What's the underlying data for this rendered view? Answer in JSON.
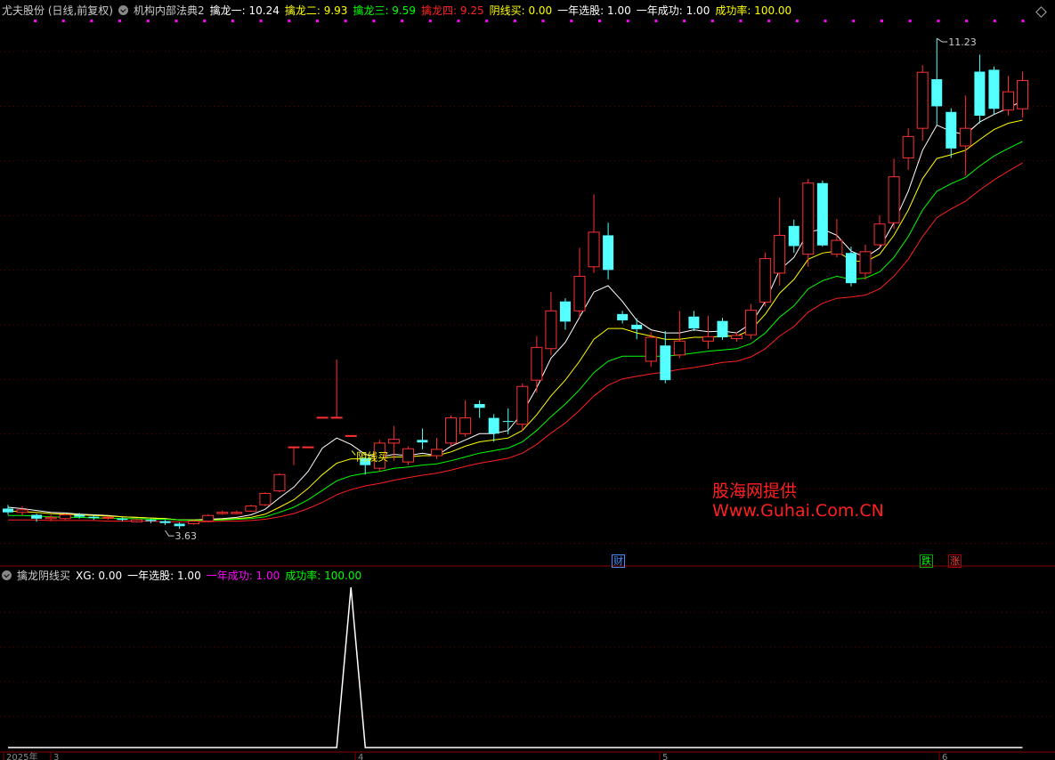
{
  "header": {
    "stock": "尤夫股份 (日线,前复权)",
    "indicator": "机构内部法典2",
    "items": [
      {
        "label": "擒龙一: 10.24",
        "color": "#ffffff"
      },
      {
        "label": "擒龙二: 9.93",
        "color": "#ffff00"
      },
      {
        "label": "擒龙三: 9.59",
        "color": "#00ff00"
      },
      {
        "label": "擒龙四: 9.25",
        "color": "#ff2020"
      },
      {
        "label": "阴线买: 0.00",
        "color": "#ffff00"
      },
      {
        "label": "一年选股: 1.00",
        "color": "#ffffff"
      },
      {
        "label": "一年成功: 1.00",
        "color": "#ffffff"
      },
      {
        "label": "成功率: 100.00",
        "color": "#ffff00"
      }
    ]
  },
  "sub_header": {
    "title": "擒龙阴线买",
    "items": [
      {
        "label": "XG: 0.00",
        "color": "#ffffff"
      },
      {
        "label": "一年选股: 1.00",
        "color": "#ffffff"
      },
      {
        "label": "一年成功: 1.00",
        "color": "#ff00ff"
      },
      {
        "label": "成功率: 100.00",
        "color": "#00ff00"
      }
    ]
  },
  "watermark": {
    "line1": "股海网提供",
    "line2": "Www.Guhai.Com.CN",
    "color": "#ff2020"
  },
  "annotations": {
    "high": "11.23",
    "low": "3.63",
    "signal": "阴线买"
  },
  "flags": [
    {
      "text": "财",
      "color": "#4a8cff"
    },
    {
      "text": "跌",
      "color": "#00ff00"
    },
    {
      "text": "涨",
      "color": "#ff2020"
    }
  ],
  "time_axis": [
    "2025年",
    "3",
    "4",
    "5",
    "6"
  ],
  "colors": {
    "up": "#ff3030",
    "down": "#54ffff",
    "bg": "#000000",
    "grid": "#7a0000"
  },
  "chart_data": {
    "type": "candlestick",
    "ylim": [
      3.3,
      11.4
    ],
    "candles": [
      [
        3.76,
        3.7,
        3.82,
        3.66
      ],
      [
        3.7,
        3.74,
        3.8,
        3.65
      ],
      [
        3.66,
        3.6,
        3.68,
        3.55
      ],
      [
        3.6,
        3.62,
        3.66,
        3.56
      ],
      [
        3.6,
        3.66,
        3.68,
        3.58
      ],
      [
        3.66,
        3.63,
        3.69,
        3.6
      ],
      [
        3.63,
        3.61,
        3.66,
        3.58
      ],
      [
        3.61,
        3.62,
        3.64,
        3.58
      ],
      [
        3.6,
        3.58,
        3.62,
        3.56
      ],
      [
        3.55,
        3.58,
        3.6,
        3.54
      ],
      [
        3.58,
        3.56,
        3.6,
        3.53
      ],
      [
        3.56,
        3.53,
        3.58,
        3.5
      ],
      [
        3.52,
        3.48,
        3.54,
        3.44
      ],
      [
        3.52,
        3.56,
        3.58,
        3.5
      ],
      [
        3.56,
        3.65,
        3.67,
        3.55
      ],
      [
        3.68,
        3.7,
        3.73,
        3.66
      ],
      [
        3.68,
        3.7,
        3.73,
        3.67
      ],
      [
        3.72,
        3.8,
        3.82,
        3.71
      ],
      [
        3.82,
        4.0,
        4.02,
        3.8
      ],
      [
        4.04,
        4.3,
        4.32,
        4.02
      ],
      [
        4.74,
        4.74,
        4.74,
        4.45
      ],
      [
        4.74,
        4.74,
        4.74,
        4.74
      ],
      [
        5.21,
        5.21,
        5.21,
        5.21
      ],
      [
        5.21,
        5.21,
        6.13,
        5.21
      ],
      [
        4.92,
        4.92,
        4.92,
        4.92
      ],
      [
        4.56,
        4.45,
        4.56,
        4.3
      ],
      [
        4.4,
        4.8,
        4.85,
        4.35
      ],
      [
        4.8,
        4.86,
        5.07,
        4.52
      ],
      [
        4.5,
        4.71,
        4.75,
        4.45
      ],
      [
        4.85,
        4.81,
        5.03,
        4.7
      ],
      [
        4.6,
        4.7,
        4.88,
        4.55
      ],
      [
        4.8,
        5.2,
        5.24,
        4.75
      ],
      [
        4.95,
        5.2,
        5.48,
        4.9
      ],
      [
        5.42,
        5.36,
        5.48,
        5.2
      ],
      [
        5.2,
        4.95,
        5.26,
        4.82
      ],
      [
        5.15,
        5.14,
        5.35,
        4.94
      ],
      [
        5.1,
        5.7,
        5.75,
        5.0
      ],
      [
        5.8,
        6.32,
        6.5,
        5.6
      ],
      [
        6.3,
        6.9,
        7.2,
        6.2
      ],
      [
        7.05,
        6.73,
        7.1,
        6.6
      ],
      [
        6.9,
        7.45,
        7.9,
        6.8
      ],
      [
        7.6,
        8.15,
        8.75,
        7.5
      ],
      [
        8.1,
        7.55,
        8.3,
        7.4
      ],
      [
        6.85,
        6.75,
        6.9,
        6.7
      ],
      [
        6.68,
        6.61,
        6.78,
        6.45
      ],
      [
        6.1,
        6.48,
        6.56,
        6.01
      ],
      [
        6.35,
        5.8,
        6.58,
        5.75
      ],
      [
        6.2,
        6.42,
        6.9,
        6.15
      ],
      [
        6.81,
        6.62,
        6.9,
        6.58
      ],
      [
        6.42,
        6.49,
        6.82,
        6.3
      ],
      [
        6.74,
        6.48,
        6.79,
        6.44
      ],
      [
        6.46,
        6.51,
        6.56,
        6.41
      ],
      [
        6.52,
        6.91,
        7.01,
        6.45
      ],
      [
        7.04,
        7.73,
        7.83,
        6.97
      ],
      [
        7.5,
        8.1,
        8.7,
        7.3
      ],
      [
        8.25,
        7.93,
        8.35,
        7.82
      ],
      [
        7.8,
        8.93,
        9.0,
        7.6
      ],
      [
        8.93,
        7.94,
        8.97,
        7.92
      ],
      [
        7.8,
        8.02,
        8.36,
        7.75
      ],
      [
        7.82,
        7.34,
        7.92,
        7.29
      ],
      [
        7.5,
        7.84,
        7.95,
        7.4
      ],
      [
        7.95,
        8.28,
        8.42,
        7.9
      ],
      [
        8.3,
        9.03,
        9.32,
        8.2
      ],
      [
        9.33,
        9.67,
        9.8,
        9.14
      ],
      [
        9.8,
        10.69,
        10.8,
        9.6
      ],
      [
        10.58,
        10.15,
        11.23,
        9.85
      ],
      [
        10.06,
        9.48,
        10.12,
        9.33
      ],
      [
        9.52,
        9.8,
        10.32,
        9.05
      ],
      [
        10.7,
        10.0,
        10.97,
        9.88
      ],
      [
        10.73,
        10.11,
        10.78,
        10.02
      ],
      [
        10.09,
        10.38,
        10.63,
        10.0
      ],
      [
        10.11,
        10.56,
        10.7,
        9.97
      ]
    ],
    "lines": [
      {
        "name": "擒龙一",
        "color": "#ffffff",
        "values": [
          3.78,
          3.76,
          3.73,
          3.7,
          3.69,
          3.67,
          3.66,
          3.65,
          3.63,
          3.62,
          3.61,
          3.6,
          3.58,
          3.58,
          3.59,
          3.6,
          3.62,
          3.66,
          3.75,
          3.93,
          4.1,
          4.35,
          4.72,
          4.88,
          4.78,
          4.62,
          4.58,
          4.62,
          4.6,
          4.64,
          4.6,
          4.75,
          4.85,
          4.95,
          4.95,
          5.0,
          5.28,
          5.68,
          6.15,
          6.4,
          6.8,
          7.2,
          7.3,
          7.05,
          6.75,
          6.6,
          6.55,
          6.55,
          6.6,
          6.57,
          6.58,
          6.55,
          6.7,
          7.05,
          7.55,
          7.75,
          8.15,
          8.2,
          8.1,
          7.85,
          7.75,
          7.9,
          8.3,
          8.8,
          9.45,
          9.85,
          9.75,
          9.7,
          9.9,
          10.02,
          10.12,
          10.24
        ]
      },
      {
        "name": "擒龙二",
        "color": "#ffff00",
        "values": [
          3.72,
          3.71,
          3.7,
          3.68,
          3.67,
          3.66,
          3.65,
          3.64,
          3.63,
          3.62,
          3.61,
          3.6,
          3.58,
          3.58,
          3.58,
          3.59,
          3.6,
          3.62,
          3.67,
          3.78,
          3.9,
          4.08,
          4.3,
          4.48,
          4.55,
          4.55,
          4.56,
          4.58,
          4.58,
          4.6,
          4.6,
          4.66,
          4.75,
          4.82,
          4.85,
          4.88,
          5.0,
          5.25,
          5.55,
          5.8,
          6.1,
          6.45,
          6.62,
          6.62,
          6.55,
          6.5,
          6.45,
          6.45,
          6.48,
          6.48,
          6.5,
          6.5,
          6.6,
          6.85,
          7.18,
          7.4,
          7.72,
          7.82,
          7.85,
          7.7,
          7.68,
          7.8,
          8.1,
          8.5,
          9.0,
          9.32,
          9.38,
          9.45,
          9.62,
          9.78,
          9.88,
          9.93
        ]
      },
      {
        "name": "擒龙三",
        "color": "#00ff00",
        "values": [
          3.65,
          3.65,
          3.64,
          3.63,
          3.62,
          3.62,
          3.61,
          3.61,
          3.6,
          3.6,
          3.59,
          3.59,
          3.58,
          3.57,
          3.57,
          3.58,
          3.59,
          3.6,
          3.63,
          3.7,
          3.78,
          3.9,
          4.05,
          4.2,
          4.28,
          4.32,
          4.35,
          4.4,
          4.42,
          4.45,
          4.47,
          4.52,
          4.58,
          4.64,
          4.68,
          4.72,
          4.82,
          5.0,
          5.22,
          5.42,
          5.65,
          5.92,
          6.1,
          6.18,
          6.18,
          6.18,
          6.18,
          6.2,
          6.23,
          6.26,
          6.28,
          6.3,
          6.38,
          6.55,
          6.8,
          6.98,
          7.25,
          7.38,
          7.45,
          7.4,
          7.42,
          7.52,
          7.75,
          8.08,
          8.5,
          8.8,
          8.92,
          9.02,
          9.2,
          9.36,
          9.48,
          9.59
        ]
      },
      {
        "name": "擒龙四",
        "color": "#ff2020",
        "values": [
          3.58,
          3.58,
          3.58,
          3.57,
          3.57,
          3.57,
          3.57,
          3.56,
          3.56,
          3.56,
          3.56,
          3.55,
          3.55,
          3.55,
          3.55,
          3.56,
          3.56,
          3.57,
          3.59,
          3.63,
          3.68,
          3.76,
          3.86,
          3.98,
          4.06,
          4.12,
          4.16,
          4.21,
          4.25,
          4.29,
          4.32,
          4.37,
          4.43,
          4.48,
          4.52,
          4.56,
          4.64,
          4.78,
          4.96,
          5.12,
          5.32,
          5.55,
          5.72,
          5.82,
          5.86,
          5.9,
          5.93,
          5.97,
          6.0,
          6.04,
          6.08,
          6.1,
          6.17,
          6.3,
          6.5,
          6.65,
          6.88,
          7.02,
          7.1,
          7.12,
          7.15,
          7.25,
          7.45,
          7.72,
          8.08,
          8.38,
          8.52,
          8.64,
          8.82,
          8.98,
          9.12,
          9.25
        ]
      }
    ],
    "xg": [
      0,
      0,
      0,
      0,
      0,
      0,
      0,
      0,
      0,
      0,
      0,
      0,
      0,
      0,
      0,
      0,
      0,
      0,
      0,
      0,
      0,
      0,
      0,
      0,
      1,
      0,
      0,
      0,
      0,
      0,
      0,
      0,
      0,
      0,
      0,
      0,
      0,
      0,
      0,
      0,
      0,
      0,
      0,
      0,
      0,
      0,
      0,
      0,
      0,
      0,
      0,
      0,
      0,
      0,
      0,
      0,
      0,
      0,
      0,
      0,
      0,
      0,
      0,
      0,
      0,
      0,
      0,
      0,
      0,
      0,
      0,
      0
    ]
  }
}
